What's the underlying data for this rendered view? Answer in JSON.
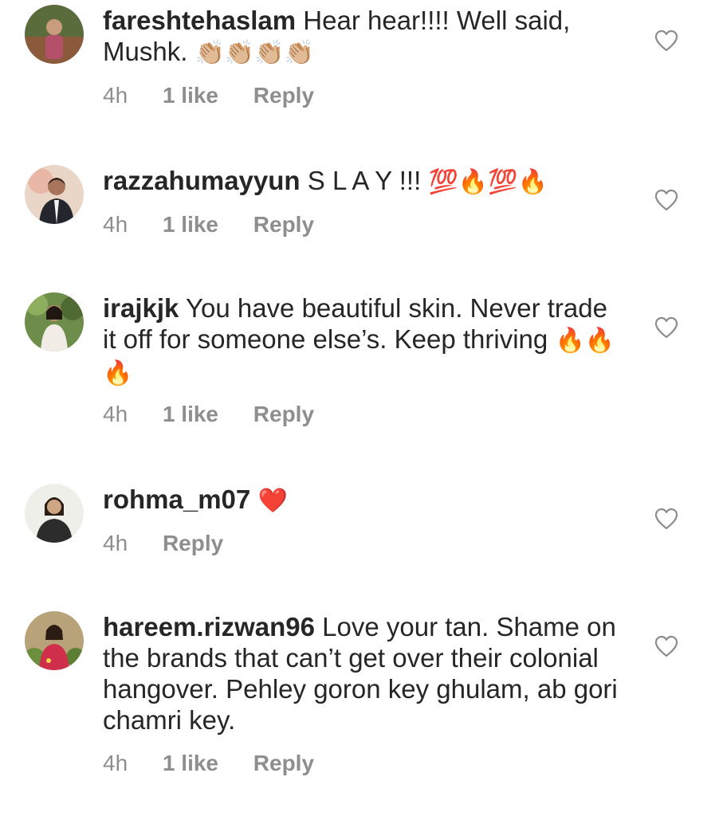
{
  "comments": [
    {
      "username": "fareshtehaslam",
      "text": "Hear hear!!!! Well said, Mushk.",
      "emoji": "👏🏼👏🏼👏🏼👏🏼",
      "time": "4h",
      "likes": "1 like",
      "reply": "Reply"
    },
    {
      "username": "razzahumayyun",
      "text": "S L A Y !!!",
      "emoji": "💯🔥💯🔥",
      "time": "4h",
      "likes": "1 like",
      "reply": "Reply"
    },
    {
      "username": "irajkjk",
      "text": "You have beautiful skin. Never trade it off for someone else’s. Keep thriving",
      "emoji": "🔥🔥🔥",
      "time": "4h",
      "likes": "1 like",
      "reply": "Reply"
    },
    {
      "username": "rohma_m07",
      "text": "",
      "emoji": "❤️",
      "time": "4h",
      "reply": "Reply"
    },
    {
      "username": "hareem.rizwan96",
      "text": "Love your tan. Shame on the brands that can’t get over their colonial hangover. Pehley goron key ghulam, ab gori chamri key.",
      "emoji": "",
      "time": "4h",
      "likes": "1 like",
      "reply": "Reply"
    }
  ],
  "colors": {
    "text": "#262626",
    "muted": "#8e8e8e",
    "heart_outline": "#8e8e8e",
    "red_heart": "#e0162b"
  }
}
